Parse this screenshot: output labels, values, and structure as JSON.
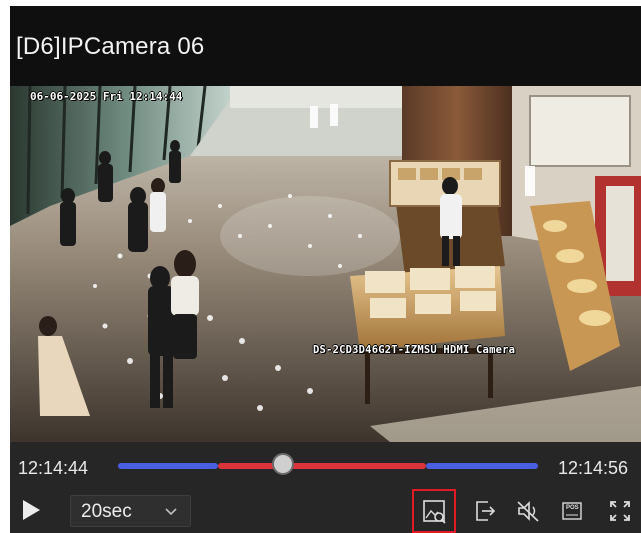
{
  "window": {
    "title": "[D6]IPCamera 06"
  },
  "video": {
    "osd_timestamp": "06-06-2025 Fri 12:14:44",
    "osd_camera_label": "DS-2CD3D46G2T-IZMSU HDMI Camera"
  },
  "playback": {
    "start_time": "12:14:44",
    "end_time": "12:14:56",
    "position_fraction": 0.38,
    "segment_colors": {
      "blue": "#4a5fe0",
      "red": "#d9343c"
    }
  },
  "controls": {
    "play_icon": "play-icon",
    "speed_label": "20sec",
    "speed_chevron_icon": "chevron-down-icon",
    "buttons": [
      {
        "name": "smart-search-icon",
        "highlighted": true,
        "highlight_color": "#e01b24"
      },
      {
        "name": "export-icon",
        "highlighted": false
      },
      {
        "name": "mute-icon",
        "highlighted": false
      },
      {
        "name": "pos-icon",
        "label": "POS",
        "highlighted": false
      },
      {
        "name": "fullscreen-icon",
        "highlighted": false
      }
    ]
  }
}
